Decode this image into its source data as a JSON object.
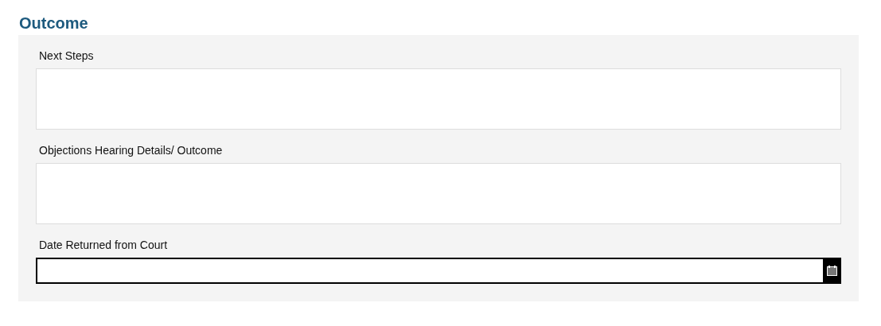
{
  "section": {
    "title": "Outcome"
  },
  "fields": [
    {
      "kind": "textarea",
      "label": "Next Steps"
    },
    {
      "kind": "textarea",
      "label": "Objections Hearing Details/ Outcome"
    },
    {
      "kind": "date",
      "label": "Date Returned from Court"
    }
  ]
}
